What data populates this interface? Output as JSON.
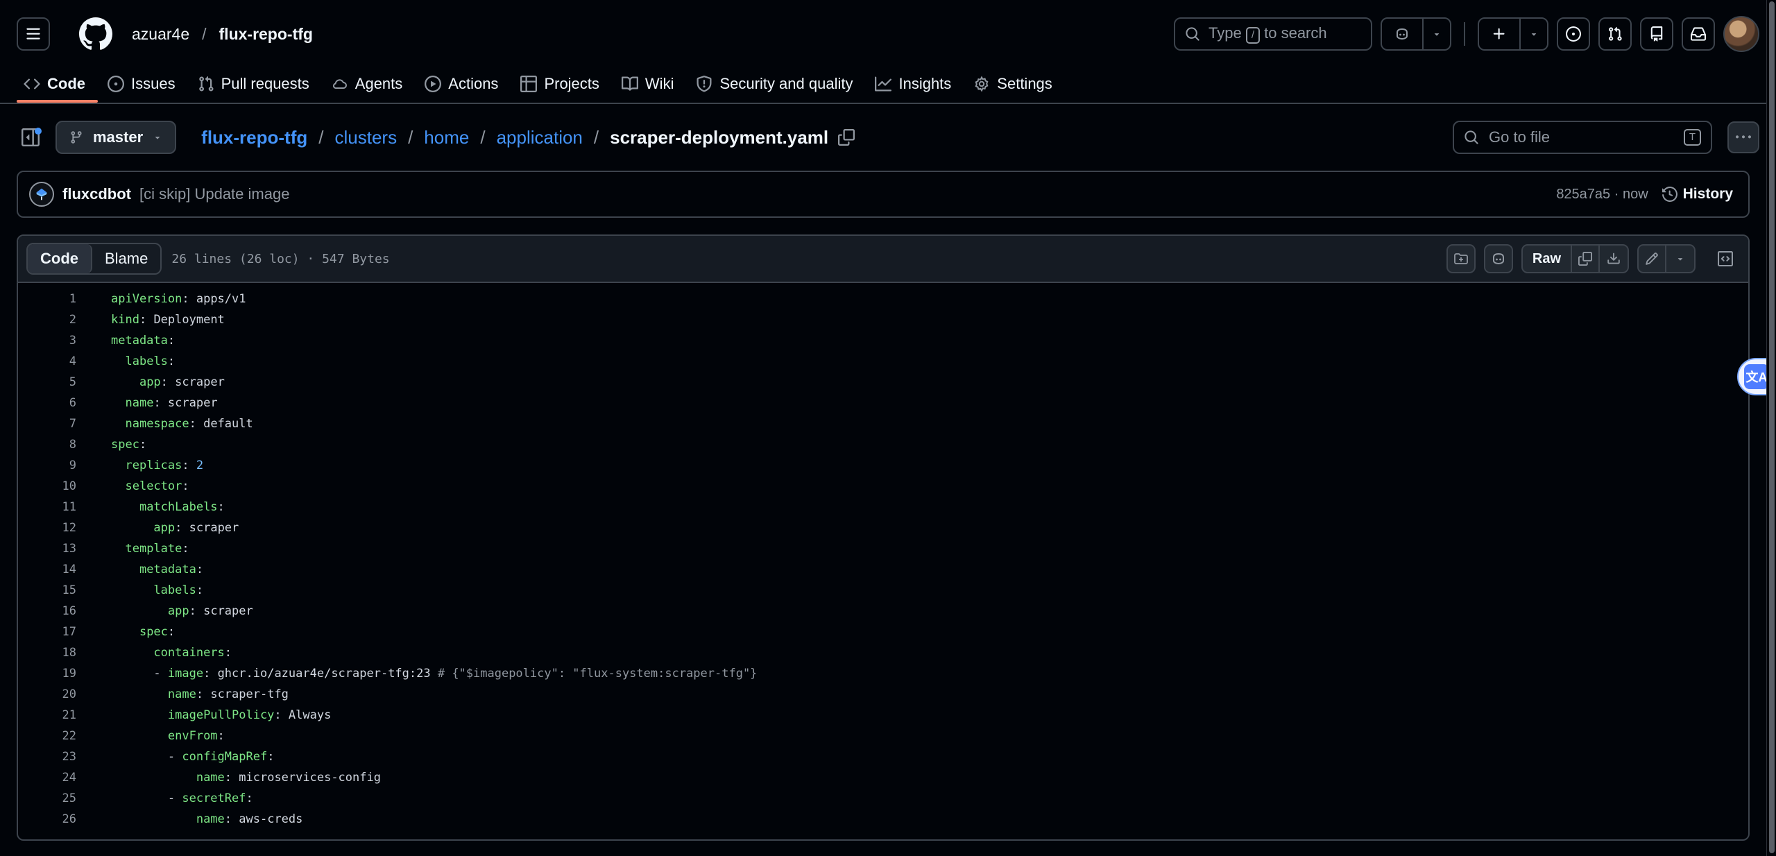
{
  "header": {
    "owner": "azuar4e",
    "separator": "/",
    "repo": "flux-repo-tfg",
    "search_text": "Type",
    "search_key": "/",
    "search_suffix": "to search"
  },
  "nav": {
    "items": [
      {
        "label": "Code",
        "icon": "code-icon",
        "active": true
      },
      {
        "label": "Issues",
        "icon": "issue-icon"
      },
      {
        "label": "Pull requests",
        "icon": "pull-request-icon"
      },
      {
        "label": "Agents",
        "icon": "agents-cloud-icon"
      },
      {
        "label": "Actions",
        "icon": "play-icon"
      },
      {
        "label": "Projects",
        "icon": "table-icon"
      },
      {
        "label": "Wiki",
        "icon": "book-icon"
      },
      {
        "label": "Security and quality",
        "icon": "shield-icon"
      },
      {
        "label": "Insights",
        "icon": "graph-icon"
      },
      {
        "label": "Settings",
        "icon": "gear-icon"
      }
    ]
  },
  "pathbar": {
    "branch": "master",
    "segments": [
      "flux-repo-tfg",
      "clusters",
      "home",
      "application"
    ],
    "separator": "/",
    "current_file": "scraper-deployment.yaml",
    "goto_placeholder": "Go to file",
    "goto_key": "T"
  },
  "commit": {
    "author": "fluxcdbot",
    "message": "[ci skip] Update image",
    "meta": "825a7a5 · now",
    "history_label": "History"
  },
  "file": {
    "tab_code": "Code",
    "tab_blame": "Blame",
    "info": "26 lines (26 loc) · 547 Bytes",
    "raw_label": "Raw"
  },
  "code_lines": [
    [
      [
        "k",
        "apiVersion"
      ],
      [
        "v",
        ": "
      ],
      [
        "v",
        "apps/v1"
      ]
    ],
    [
      [
        "k",
        "kind"
      ],
      [
        "v",
        ": "
      ],
      [
        "v",
        "Deployment"
      ]
    ],
    [
      [
        "k",
        "metadata"
      ],
      [
        "v",
        ":"
      ]
    ],
    [
      [
        "v",
        "  "
      ],
      [
        "k",
        "labels"
      ],
      [
        "v",
        ":"
      ]
    ],
    [
      [
        "v",
        "    "
      ],
      [
        "k",
        "app"
      ],
      [
        "v",
        ": "
      ],
      [
        "v",
        "scraper"
      ]
    ],
    [
      [
        "v",
        "  "
      ],
      [
        "k",
        "name"
      ],
      [
        "v",
        ": "
      ],
      [
        "v",
        "scraper"
      ]
    ],
    [
      [
        "v",
        "  "
      ],
      [
        "k",
        "namespace"
      ],
      [
        "v",
        ": "
      ],
      [
        "v",
        "default"
      ]
    ],
    [
      [
        "k",
        "spec"
      ],
      [
        "v",
        ":"
      ]
    ],
    [
      [
        "v",
        "  "
      ],
      [
        "k",
        "replicas"
      ],
      [
        "v",
        ": "
      ],
      [
        "n",
        "2"
      ]
    ],
    [
      [
        "v",
        "  "
      ],
      [
        "k",
        "selector"
      ],
      [
        "v",
        ":"
      ]
    ],
    [
      [
        "v",
        "    "
      ],
      [
        "k",
        "matchLabels"
      ],
      [
        "v",
        ":"
      ]
    ],
    [
      [
        "v",
        "      "
      ],
      [
        "k",
        "app"
      ],
      [
        "v",
        ": "
      ],
      [
        "v",
        "scraper"
      ]
    ],
    [
      [
        "v",
        "  "
      ],
      [
        "k",
        "template"
      ],
      [
        "v",
        ":"
      ]
    ],
    [
      [
        "v",
        "    "
      ],
      [
        "k",
        "metadata"
      ],
      [
        "v",
        ":"
      ]
    ],
    [
      [
        "v",
        "      "
      ],
      [
        "k",
        "labels"
      ],
      [
        "v",
        ":"
      ]
    ],
    [
      [
        "v",
        "        "
      ],
      [
        "k",
        "app"
      ],
      [
        "v",
        ": "
      ],
      [
        "v",
        "scraper"
      ]
    ],
    [
      [
        "v",
        "    "
      ],
      [
        "k",
        "spec"
      ],
      [
        "v",
        ":"
      ]
    ],
    [
      [
        "v",
        "      "
      ],
      [
        "k",
        "containers"
      ],
      [
        "v",
        ":"
      ]
    ],
    [
      [
        "v",
        "      - "
      ],
      [
        "k",
        "image"
      ],
      [
        "v",
        ": "
      ],
      [
        "v",
        "ghcr.io/azuar4e/scraper-tfg:23"
      ],
      [
        "c",
        " # {\"$imagepolicy\": \"flux-system:scraper-tfg\"}"
      ]
    ],
    [
      [
        "v",
        "        "
      ],
      [
        "k",
        "name"
      ],
      [
        "v",
        ": "
      ],
      [
        "v",
        "scraper-tfg"
      ]
    ],
    [
      [
        "v",
        "        "
      ],
      [
        "k",
        "imagePullPolicy"
      ],
      [
        "v",
        ": "
      ],
      [
        "v",
        "Always"
      ]
    ],
    [
      [
        "v",
        "        "
      ],
      [
        "k",
        "envFrom"
      ],
      [
        "v",
        ":"
      ]
    ],
    [
      [
        "v",
        "        - "
      ],
      [
        "k",
        "configMapRef"
      ],
      [
        "v",
        ":"
      ]
    ],
    [
      [
        "v",
        "            "
      ],
      [
        "k",
        "name"
      ],
      [
        "v",
        ": "
      ],
      [
        "v",
        "microservices-config"
      ]
    ],
    [
      [
        "v",
        "        - "
      ],
      [
        "k",
        "secretRef"
      ],
      [
        "v",
        ":"
      ]
    ],
    [
      [
        "v",
        "            "
      ],
      [
        "k",
        "name"
      ],
      [
        "v",
        ": "
      ],
      [
        "v",
        "aws-creds"
      ]
    ]
  ],
  "translate_widget": "文A"
}
